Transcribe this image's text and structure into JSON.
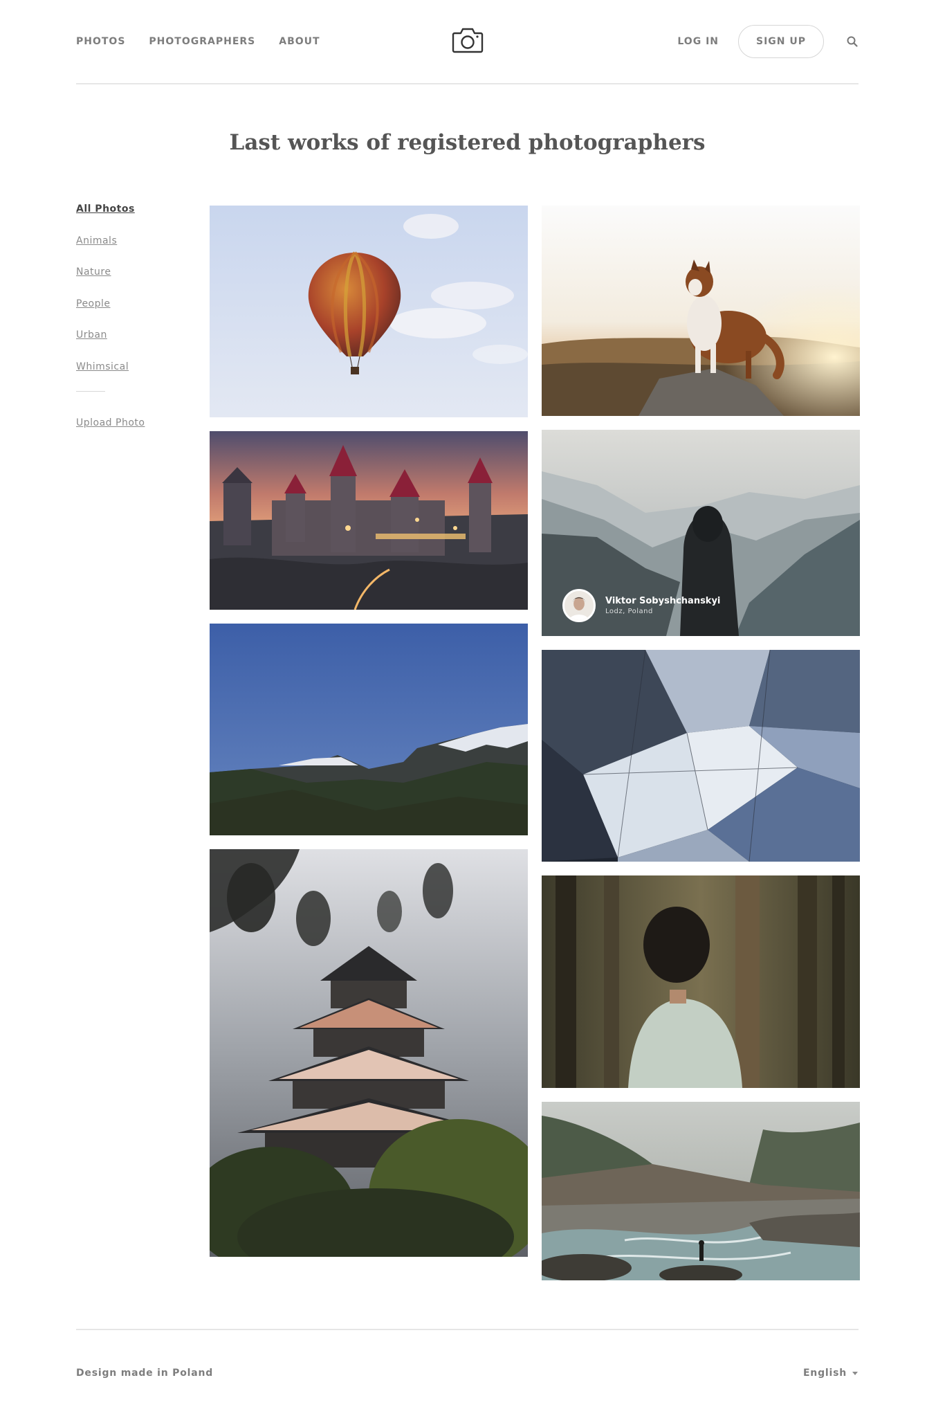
{
  "nav": {
    "photos": "PHOTOS",
    "photographers": "PHOTOGRAPHERS",
    "about": "ABOUT",
    "login": "LOG IN",
    "signup": "SIGN UP"
  },
  "page_title": "Last works of registered photographers",
  "sidebar": {
    "categories": [
      "All Photos",
      "Animals",
      "Nature",
      "People",
      "Urban",
      "Whimsical"
    ],
    "upload": "Upload Photo"
  },
  "gallery": {
    "featured_credit": {
      "name": "Viktor Sobyshchanskyi",
      "location": "Lodz, Poland"
    }
  },
  "footer": {
    "left": "Design made in Poland",
    "language": "English"
  },
  "icons": [
    "camera-logo-icon",
    "search-icon",
    "chevron-down-icon"
  ]
}
